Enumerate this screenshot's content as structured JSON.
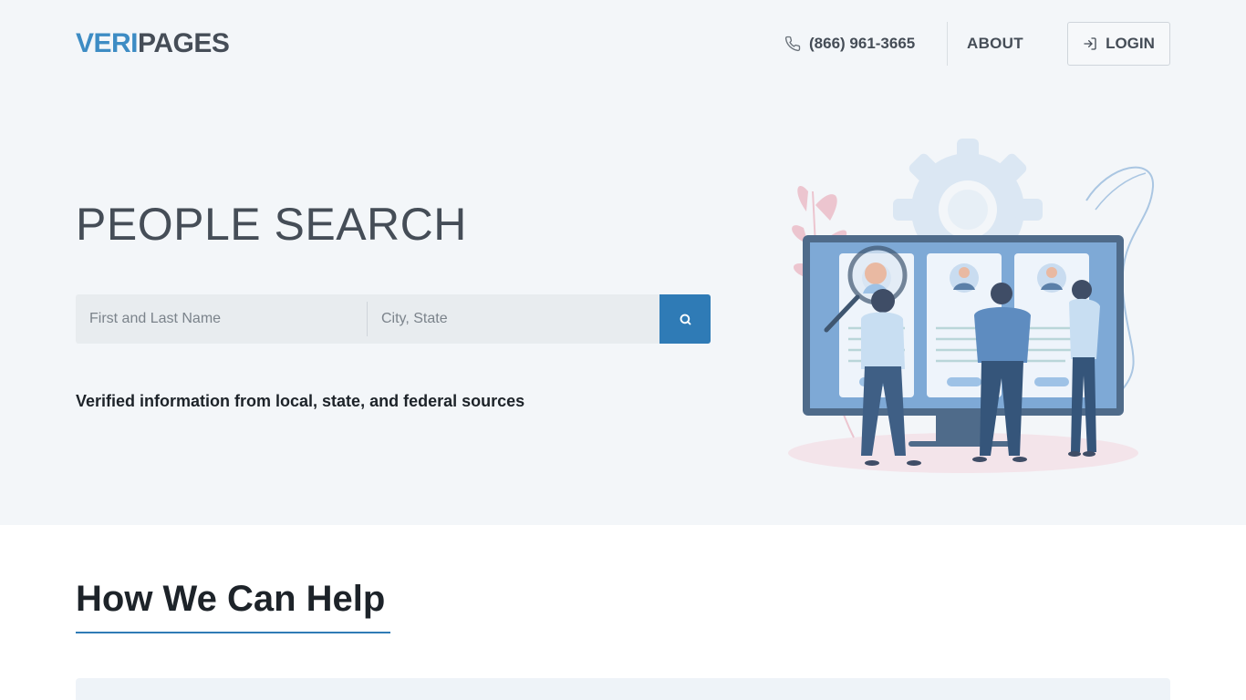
{
  "header": {
    "logo_part1": "VERI",
    "logo_part2": "PAGES",
    "phone": "(866) 961-3665",
    "about_label": "ABOUT",
    "login_label": "LOGIN"
  },
  "hero": {
    "title": "PEOPLE SEARCH",
    "name_placeholder": "First and Last Name",
    "location_placeholder": "City, State",
    "tagline": "Verified information from local, state, and federal sources"
  },
  "help": {
    "title": "How We Can Help"
  },
  "colors": {
    "brand_blue": "#3d8cc4",
    "button_blue": "#2f7bb6",
    "hero_bg": "#f3f6f9",
    "text_dark": "#454d57"
  },
  "icons": {
    "phone": "phone-icon",
    "login": "login-icon",
    "search": "search-icon"
  }
}
